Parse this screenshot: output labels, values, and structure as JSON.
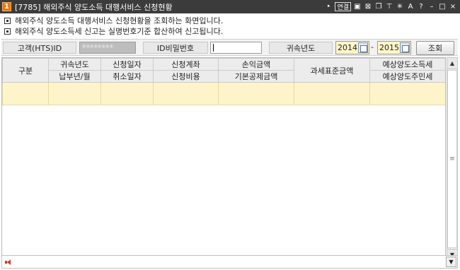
{
  "window": {
    "number": "1",
    "title": "[7785] 해외주식 양도소득 대행서비스 신청현황",
    "tools": {
      "link_badge": "연결"
    }
  },
  "notices": [
    "해외주식 양도소득 대행서비스 신청현황을 조회하는 화면입니다.",
    "해외주식 양도소득세 신고는 실명번호기준 합산하여 신고됩니다."
  ],
  "search": {
    "customer_label": "고객(HTS)ID",
    "customer_value": "********",
    "password_label": "ID비밀번호",
    "password_value": "",
    "year_label": "귀속년도",
    "year_from": "2014",
    "year_to": "2015",
    "separator": "-",
    "query_button": "조회"
  },
  "table": {
    "col_gubun": "구분",
    "col_year": "귀속년도",
    "col_year_sub": "납부년/월",
    "col_apply_date": "신청일자",
    "col_apply_date_sub": "취소일자",
    "col_account": "신청계좌",
    "col_account_sub": "신청비용",
    "col_profit": "손익금액",
    "col_profit_sub": "기본공제금액",
    "col_taxbase": "과세표준금액",
    "col_tax": "예상양도소득세",
    "col_tax_sub": "예상양도주민세",
    "rows": [
      [
        "",
        "",
        "",
        "",
        "",
        "",
        ""
      ]
    ]
  }
}
